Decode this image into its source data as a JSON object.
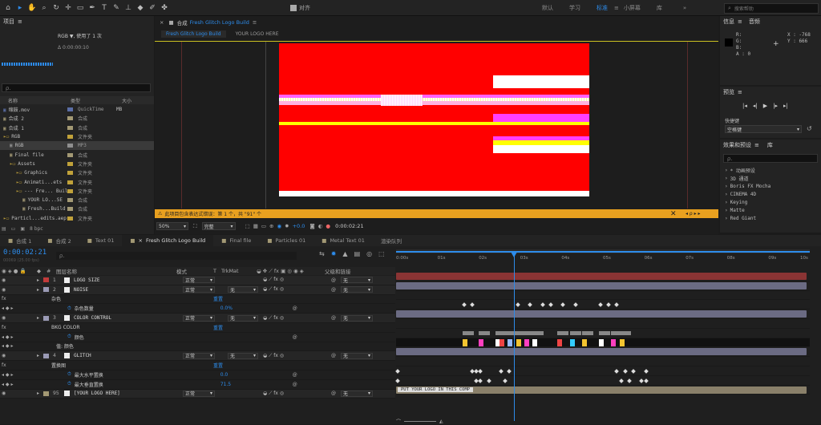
{
  "toolbar": {
    "align_label": "对齐",
    "workspaces": [
      "默认",
      "学习",
      "标准",
      "小屏幕",
      "库"
    ],
    "active_workspace": "标准",
    "search_placeholder": "搜索帮助",
    "more": "»"
  },
  "project": {
    "title": "项目",
    "menu": "≡",
    "footage_name": "RGB ▼",
    "footage_used": ", 使用了 1 次",
    "footage_dur": "Δ 0:00:00:10",
    "search_placeholder": "⍴.",
    "cols": {
      "name": "名称",
      "type": "类型",
      "size": "大小"
    },
    "items": [
      {
        "indent": 0,
        "name": "缩鼓.mov",
        "type": "QuickTime",
        "size": "MB",
        "color": "#5b6ea6"
      },
      {
        "indent": 0,
        "name": "合成 2",
        "type": "合成",
        "size": "",
        "color": "#a39974"
      },
      {
        "indent": 0,
        "name": "合成 1",
        "type": "合成",
        "size": "",
        "color": "#a39974"
      },
      {
        "indent": 0,
        "name": "RGB",
        "type": "文件夹",
        "size": "",
        "color": "#c1a23a"
      },
      {
        "indent": 1,
        "name": "RGB",
        "type": "MP3",
        "size": "",
        "color": "#8f8f8f"
      },
      {
        "indent": 1,
        "name": "Final file",
        "type": "合成",
        "size": "",
        "color": "#a39974"
      },
      {
        "indent": 1,
        "name": "Assets",
        "type": "文件夹",
        "size": "",
        "color": "#c1a23a"
      },
      {
        "indent": 2,
        "name": "Graphics",
        "type": "文件夹",
        "size": "",
        "color": "#c1a23a"
      },
      {
        "indent": 2,
        "name": "Animati...ets",
        "type": "文件夹",
        "size": "",
        "color": "#c1a23a"
      },
      {
        "indent": 2,
        "name": "--- Fre... Build",
        "type": "文件夹",
        "size": "",
        "color": "#c1a23a"
      },
      {
        "indent": 3,
        "name": "YOUR LO...SE",
        "type": "合成",
        "size": "",
        "color": "#a39974"
      },
      {
        "indent": 3,
        "name": "Fresh...Build",
        "type": "合成",
        "size": "",
        "color": "#a39974"
      },
      {
        "indent": 0,
        "name": "Particl...edits.aep",
        "type": "文件夹",
        "size": "",
        "color": "#c1a23a"
      }
    ],
    "bpc": "8 bpc"
  },
  "comp": {
    "tab_prefix": "合成",
    "tab_name": "Fresh Glitch Logo Build",
    "tab_menu": "≡",
    "crumb1": "Fresh Glitch Logo Build",
    "crumb2": "YOUR LOGO HERE",
    "warning": "此项目包含表达式错误：第 1 个，共 \"91\" 个",
    "zoom": "50%",
    "quality": "完整",
    "exposure": "+0.0",
    "timecode": "0:00:02:21"
  },
  "info": {
    "title": "信息",
    "tab2": "音频",
    "r": "R:",
    "g": "G:",
    "b": "B:",
    "a": "A : 0",
    "x": "X : -768",
    "y": "Y : 666"
  },
  "preview": {
    "title": "预览",
    "shortcut_label": "快捷键",
    "shortcut_value": "空格键"
  },
  "effects": {
    "title": "效果和预设",
    "tab2": "库",
    "search_placeholder": "⍴.",
    "items": [
      "* 动画预设",
      "3D 通道",
      "Boris FX Mocha",
      "CINEMA 4D",
      "Keying",
      "Matte",
      "Red Giant"
    ]
  },
  "timeline": {
    "tabs": [
      "合成 1",
      "合成 2",
      "Text 01",
      "Fresh Glitch Logo Build",
      "Final file",
      "Particles 01",
      "Metal Text 01",
      "渲染队列"
    ],
    "active_tab": "Fresh Glitch Logo Build",
    "timecode": "0:00:02:21",
    "fps": "00069 (25.00 fps)",
    "search_placeholder": "⍴.",
    "cols": {
      "layer": "图层名称",
      "mode": "模式",
      "t": "T",
      "trkmat": "TrkMat",
      "parent": "父级和链接"
    },
    "ruler": [
      "0:00s",
      "01s",
      "02s",
      "03s",
      "04s",
      "05s",
      "06s",
      "07s",
      "08s",
      "09s",
      "10s"
    ],
    "playhead_sec": 2.84,
    "rows": [
      {
        "kind": "layer",
        "num": "1",
        "name": "LOGO SIZE",
        "mode": "正常",
        "trk": "",
        "parent": "无",
        "color": "#c23b3b",
        "bar": "#8a3434"
      },
      {
        "kind": "layer",
        "num": "2",
        "name": "NOISE",
        "mode": "正常",
        "trk": "无",
        "parent": "无",
        "color": "#9a9ab5",
        "bar": "#6b6b83"
      },
      {
        "kind": "group",
        "name": "杂色",
        "value": "重置"
      },
      {
        "kind": "prop",
        "name": "杂色数量",
        "value": "0.0%",
        "keys": [
          1.6,
          1.8,
          2.9,
          3.2,
          3.5,
          3.7,
          4.0,
          4.3,
          4.9,
          5.1,
          5.3
        ]
      },
      {
        "kind": "layer",
        "num": "3",
        "name": "COLOR CONTROL",
        "mode": "正常",
        "trk": "无",
        "parent": "无",
        "color": "#9a9ab5",
        "bar": "#6b6b83"
      },
      {
        "kind": "group",
        "name": "BKG COLOR",
        "value": "重置"
      },
      {
        "kind": "prop",
        "name": "颜色",
        "value": "",
        "keys": []
      },
      {
        "kind": "sub",
        "name": "值: 颜色",
        "value": "",
        "keys": []
      },
      {
        "kind": "layer",
        "num": "4",
        "name": "GLITCH",
        "mode": "正常",
        "trk": "无",
        "parent": "无",
        "color": "#9a9ab5",
        "bar": "#6b6b83"
      },
      {
        "kind": "group",
        "name": "置换图",
        "value": "重置"
      },
      {
        "kind": "prop",
        "name": "最大水平置换",
        "value": "0.0",
        "keys": [
          0,
          1.8,
          1.9,
          2.0,
          2.5,
          2.7,
          5.3,
          5.5,
          5.7,
          6.0
        ]
      },
      {
        "kind": "prop",
        "name": "最大垂直置换",
        "value": "71.5",
        "keys": [
          0,
          1.9,
          2.0,
          2.2,
          2.6,
          5.4,
          5.6,
          5.9,
          6.0
        ]
      },
      {
        "kind": "layer",
        "num": "95",
        "name": "[YOUR LOGO HERE]",
        "mode": "正常",
        "trk": "",
        "parent": "无",
        "color": "#a39974",
        "bar": "#8a806a",
        "bar_label": "PUT YOUR LOGO IN THIS COMP"
      }
    ]
  },
  "colors": {
    "accent": "#2d8ceb",
    "comp_bg": "#ff0000",
    "warning_bar": "#e8a01f"
  }
}
